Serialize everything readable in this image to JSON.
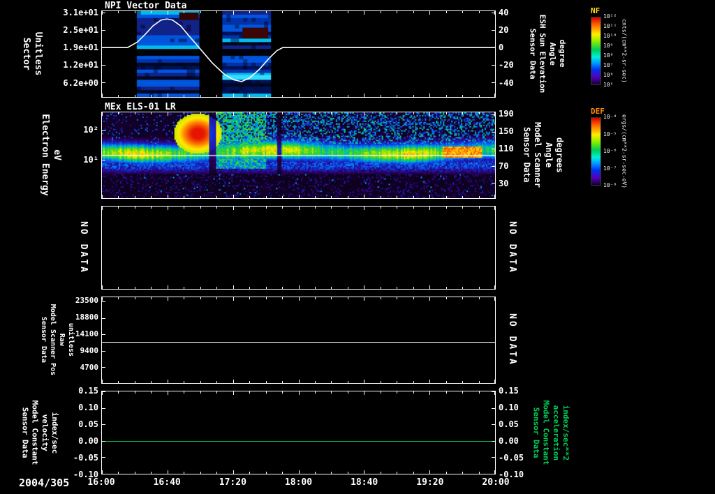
{
  "page": {
    "date_label": "2004/305",
    "x_tick_labels": [
      "16:00",
      "16:40",
      "17:20",
      "18:00",
      "18:40",
      "19:20",
      "20:00"
    ],
    "colors": {
      "bg": "#000000",
      "fg": "#ffffff",
      "green": "#00cc55",
      "nf_label": "#ffdd00",
      "def_label": "#ff8800",
      "npi_line": "#ffffff",
      "scanner_line": "#ffffff"
    }
  },
  "chart_data": [
    {
      "type": "heatmap",
      "title": "NPI Vector Data",
      "left_axis": {
        "label": "Sector\nUnitless",
        "tick_values": [
          "3.1e+01",
          "2.5e+01",
          "1.9e+01",
          "1.2e+01",
          "6.2e+00"
        ],
        "tick_fracs": [
          0.02,
          0.222,
          0.424,
          0.626,
          0.828
        ]
      },
      "right_axis": {
        "label": "Sensor Data\nESH Sun Elevation\nAngle\ndegree",
        "tick_values": [
          "40",
          "20",
          "0",
          "-20",
          "-40"
        ],
        "tick_fracs": [
          0.02,
          0.222,
          0.424,
          0.626,
          0.828
        ]
      },
      "colorbar": {
        "name": "NF",
        "unit": "cnts/(cm**2-sr-sec)",
        "tick_labels": [
          "10¹²",
          "10¹¹",
          "10¹⁰",
          "10⁹",
          "10⁸",
          "10⁷",
          "10⁶",
          "10⁵"
        ]
      },
      "data_blocks": [
        {
          "x0": 0.088,
          "x1": 0.248
        },
        {
          "x0": 0.306,
          "x1": 0.43
        }
      ],
      "overlay_line": {
        "series": "ESH Sun Elevation Angle",
        "points": [
          [
            0,
            0.424
          ],
          [
            0.065,
            0.424
          ],
          [
            0.09,
            0.36
          ],
          [
            0.11,
            0.27
          ],
          [
            0.13,
            0.17
          ],
          [
            0.15,
            0.105
          ],
          [
            0.165,
            0.09
          ],
          [
            0.18,
            0.105
          ],
          [
            0.2,
            0.17
          ],
          [
            0.22,
            0.28
          ],
          [
            0.25,
            0.44
          ],
          [
            0.28,
            0.6
          ],
          [
            0.31,
            0.73
          ],
          [
            0.335,
            0.8
          ],
          [
            0.355,
            0.82
          ],
          [
            0.375,
            0.78
          ],
          [
            0.4,
            0.68
          ],
          [
            0.425,
            0.55
          ],
          [
            0.445,
            0.46
          ],
          [
            0.46,
            0.424
          ],
          [
            1,
            0.424
          ]
        ]
      }
    },
    {
      "type": "heatmap",
      "title": "MEx ELS-01 LR",
      "left_axis": {
        "label": "Electron Energy\neV",
        "tick_values": [
          "10²",
          "10¹"
        ],
        "tick_fracs": [
          0.208,
          0.552
        ]
      },
      "right_axis": {
        "label": "Sensor Data\nModel Scanner\nAngle\ndegrees",
        "tick_values": [
          "190",
          "150",
          "110",
          "70",
          "30"
        ],
        "tick_fracs": [
          0.024,
          0.224,
          0.424,
          0.624,
          0.824
        ]
      },
      "colorbar": {
        "name": "DEF",
        "unit": "ergs/(cm**2-sr-sec-eV)",
        "tick_labels": [
          "10⁻⁴",
          "10⁻⁵",
          "10⁻⁶",
          "10⁻⁷",
          "10⁻⁸"
        ]
      }
    },
    {
      "type": "empty",
      "left_label": "NO DATA",
      "right_label": "NO DATA"
    },
    {
      "type": "line",
      "left_axis": {
        "label": "Sensor Data\nModel Scanner Pos\nRaw\nunitless",
        "tick_values": [
          "23500",
          "18800",
          "14100",
          "9400",
          "4700"
        ],
        "tick_fracs": [
          0.048,
          0.24,
          0.432,
          0.624,
          0.816
        ]
      },
      "right_label": "NO DATA",
      "line": {
        "value": 11900,
        "frac": 0.52,
        "color": "#ffffff"
      }
    },
    {
      "type": "line",
      "left_axis": {
        "label": "Sensor Data\nModel Constant\nvelocity\nindex/sec",
        "tick_values": [
          "0.15",
          "0.10",
          "0.05",
          "0.00",
          "-0.05",
          "-0.10"
        ],
        "tick_fracs": [
          0,
          0.2,
          0.4,
          0.6,
          0.8,
          1
        ]
      },
      "right_axis": {
        "label": "Sensor Data\nModel Constant\nacceleration\nindex/sec**2",
        "tick_values": [
          "0.15",
          "0.10",
          "0.05",
          "0.00",
          "-0.05",
          "-0.10"
        ],
        "tick_fracs": [
          0,
          0.2,
          0.4,
          0.6,
          0.8,
          1
        ]
      },
      "line": {
        "value": 0.0,
        "frac": 0.6,
        "color": "#00cc55"
      }
    }
  ]
}
